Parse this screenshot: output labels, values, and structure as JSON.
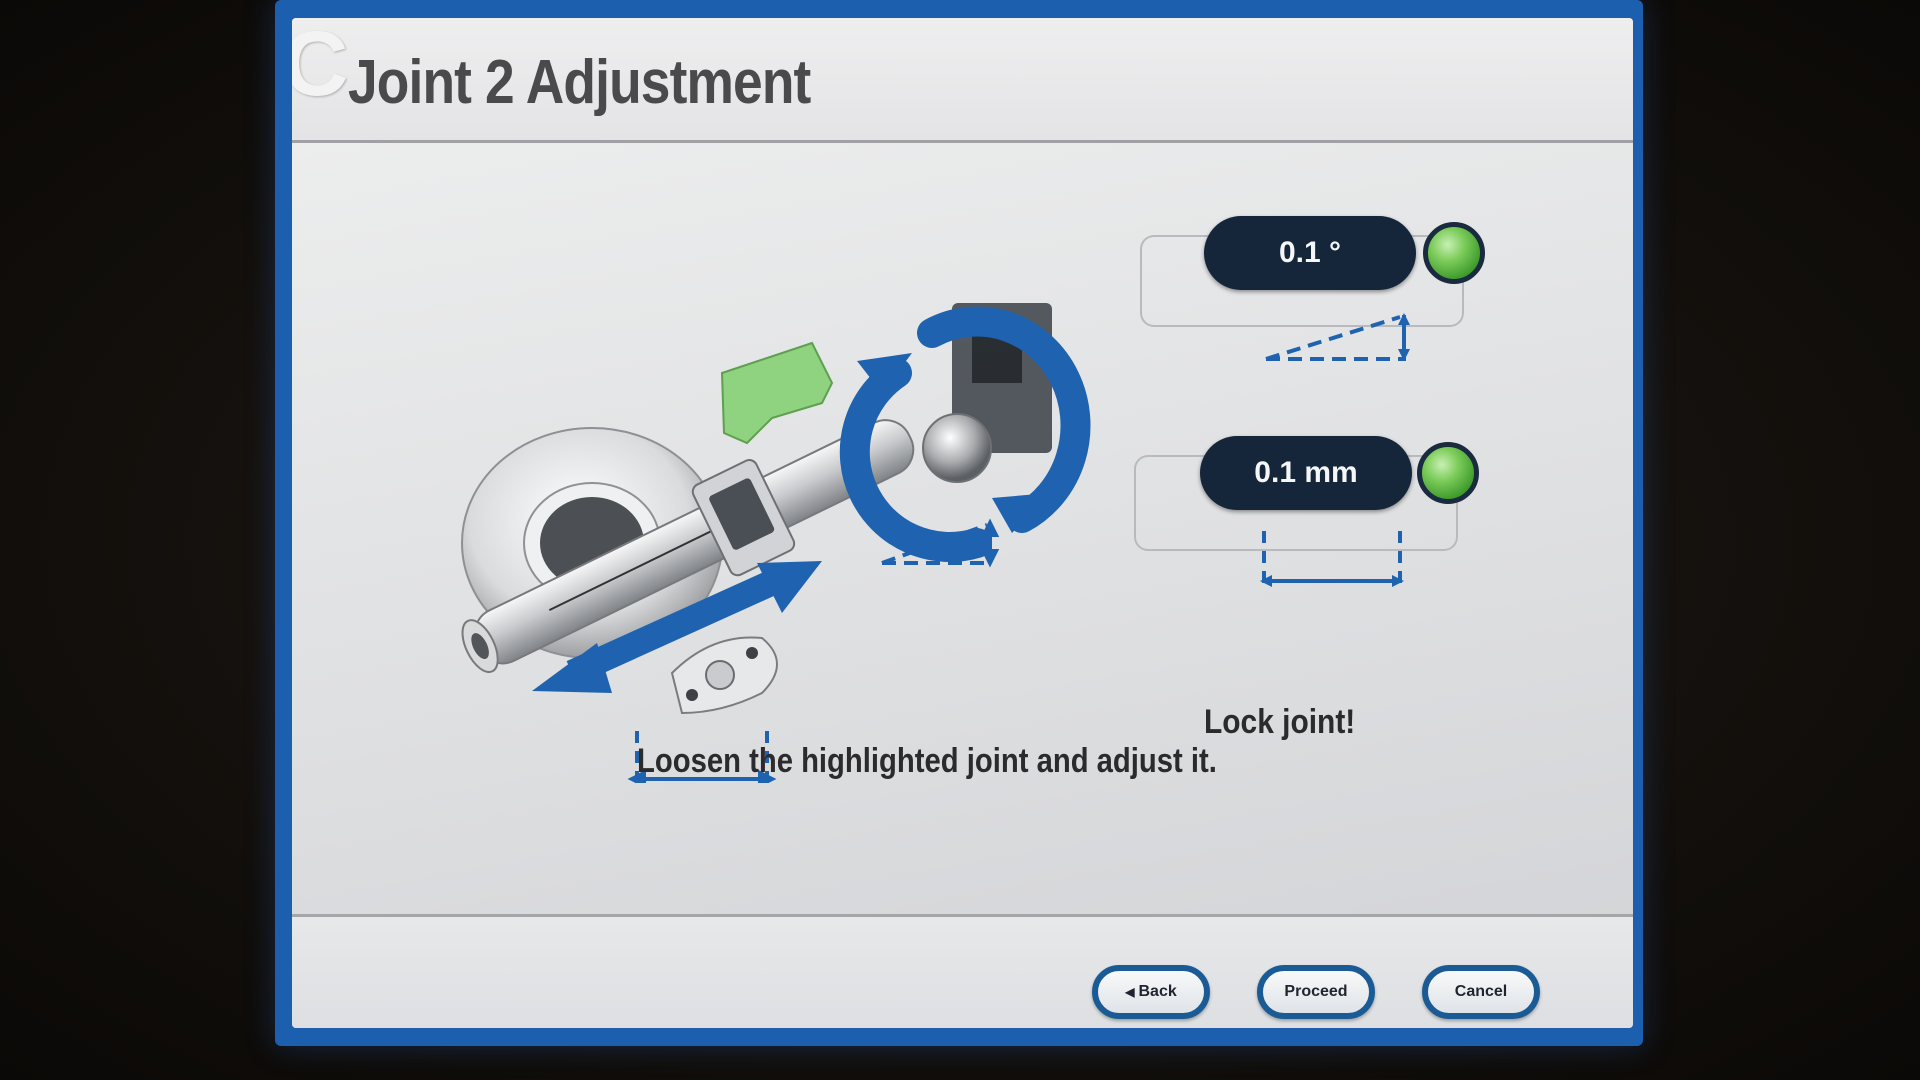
{
  "screen": {
    "letter": "C",
    "title": "Joint 2 Adjustment"
  },
  "readings": {
    "angle": {
      "value": "0.1 °",
      "status": "ok",
      "status_color": "#5fb845"
    },
    "distance": {
      "value": "0.1 mm",
      "status": "ok",
      "status_color": "#5fb845"
    }
  },
  "messages": {
    "lock": "Lock joint!",
    "instruction": "Loosen the highlighted joint and adjust it."
  },
  "buttons": {
    "back": "Back",
    "proceed": "Proceed",
    "cancel": "Cancel"
  },
  "colors": {
    "frame": "#1c5fae",
    "arrow_blue": "#1f63b0",
    "highlight_green": "#8fd27f",
    "reading_bg": "#15253a"
  },
  "icons": {
    "back": "left-triangle-icon",
    "status": "status-light-icon"
  }
}
